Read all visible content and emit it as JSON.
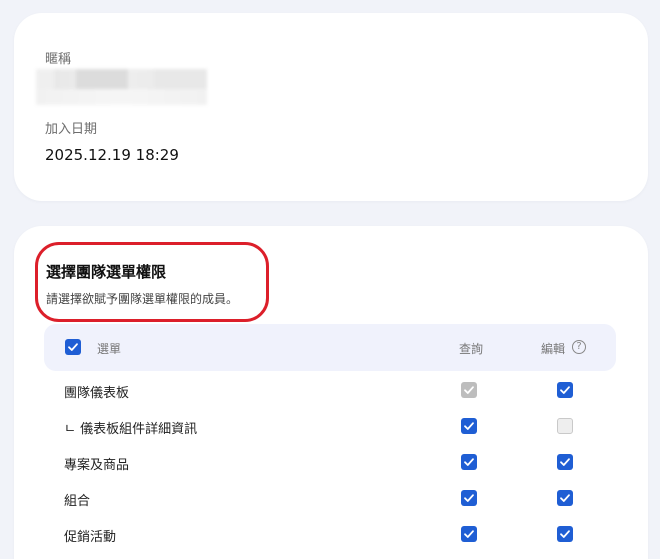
{
  "profile": {
    "nickname_label": "暱稱",
    "join_date_label": "加入日期",
    "join_date_value": "2025.12.19 18:29"
  },
  "permissions": {
    "title": "選擇團隊選單權限",
    "subtitle": "請選擇欲賦予團隊選單權限的成員。",
    "header": {
      "menu": "選單",
      "query": "查詢",
      "edit": "編輯",
      "help_icon": "question-circle-icon"
    },
    "rows": [
      {
        "label": "團隊儀表板",
        "query": "checked-disabled",
        "edit": "checked"
      },
      {
        "label": "ㄴ 儀表板組件詳細資訊",
        "query": "checked",
        "edit": "unchecked"
      },
      {
        "label": "專案及商品",
        "query": "checked",
        "edit": "checked"
      },
      {
        "label": "組合",
        "query": "checked",
        "edit": "checked"
      },
      {
        "label": "促銷活動",
        "query": "checked",
        "edit": "checked"
      }
    ]
  },
  "colors": {
    "accent": "#1f5ed4",
    "highlight": "#dc1f2a",
    "background": "#f1f3f9"
  }
}
